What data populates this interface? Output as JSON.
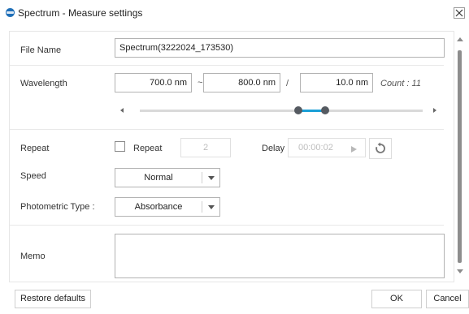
{
  "window": {
    "title": "Spectrum - Measure settings",
    "icon": "app-logo-icon",
    "close_icon": "close-icon"
  },
  "file_name": {
    "label": "File Name",
    "value": "Spectrum(3222024_173530)"
  },
  "wavelength": {
    "label": "Wavelength",
    "start": "700.0 nm",
    "range_sep": "~",
    "end": "800.0 nm",
    "step_sep": "/",
    "step": "10.0 nm",
    "count": "Count : 11",
    "slider": {
      "low_fraction": 0.56,
      "high_fraction": 0.655,
      "fill_color": "#1a9fd6"
    }
  },
  "repeat": {
    "label": "Repeat",
    "checkbox_label": "Repeat",
    "checked": false,
    "count_value": "2",
    "delay_label": "Delay",
    "delay_value": "00:00:02",
    "play_icon": "play-icon",
    "reset_icon": "reset-icon"
  },
  "speed": {
    "label": "Speed",
    "value": "Normal"
  },
  "photometric": {
    "label": "Photometric Type :",
    "value": "Absorbance"
  },
  "memo": {
    "label": "Memo",
    "value": ""
  },
  "buttons": {
    "restore": "Restore defaults",
    "ok": "OK",
    "cancel": "Cancel"
  }
}
